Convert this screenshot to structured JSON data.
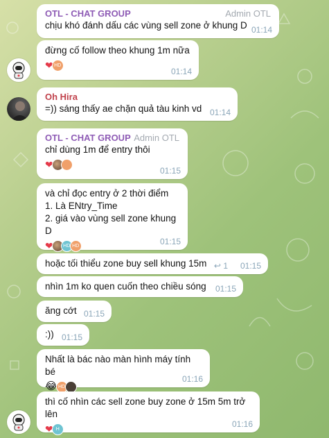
{
  "messages": [
    {
      "sender": "OTL - CHAT GROUP",
      "role": "Admin OTL",
      "text": "chịu khó đánh dấu các vùng sell zone ở khung D",
      "time": "01:14"
    },
    {
      "text": "đừng cố follow theo khung 1m nữa",
      "time": "01:14",
      "reactions": [
        "heart",
        "HD"
      ]
    },
    {
      "sender": "Oh Hira",
      "text": "=))  sáng thấy ae chặn quả tàu kinh vd",
      "time": "01:14"
    },
    {
      "sender": "OTL - CHAT GROUP",
      "role": "Admin OTL",
      "text": "chỉ dùng 1m để entry thôi",
      "time": "01:15",
      "reactions": [
        "heart",
        "photo",
        "orange"
      ]
    },
    {
      "text": "và chỉ đọc entry ở 2 thời điểm\n1. Là ENtry_Time\n2. giá vào vùng sell zone khung D",
      "time": "01:15",
      "reactions": [
        "heart",
        "photo",
        "HD",
        "orange"
      ]
    },
    {
      "text": "hoặc tối thiểu zone buy sell khung 15m",
      "time": "01:15",
      "replies": "1"
    },
    {
      "text": "nhìn 1m ko quen cuốn theo chiều sóng",
      "time": "01:15"
    },
    {
      "text": "ăng cớt",
      "time": "01:15"
    },
    {
      "text": ":))",
      "time": "01:15"
    },
    {
      "text": "Nhất là bác nào màn hình máy tính bé",
      "time": "01:16",
      "reactions": [
        "😂",
        "HD",
        "dark"
      ]
    },
    {
      "text": "thì cố nhìn các sell zone buy zone ở 15m 5m trở lên",
      "time": "01:16",
      "reactions": [
        "heart",
        "H"
      ]
    }
  ],
  "colors": {
    "admin_name": "#8e5bb5",
    "hira_name": "#c0414b",
    "heart": "#e53a4a",
    "time": "#8aa5b8"
  },
  "icons": {
    "heart": "heart-icon",
    "reply": "reply-arrow-icon",
    "bot_avatar": "astronaut-avatar"
  }
}
